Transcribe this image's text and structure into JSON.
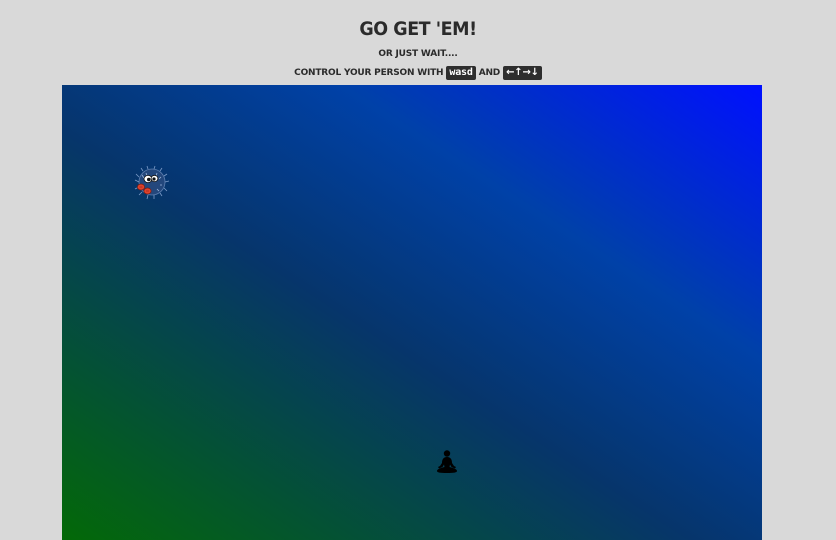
{
  "header": {
    "title": "Go get 'em!",
    "subtitle": "or just wait....",
    "controls_prefix": "control your person with",
    "wasd_key": "wasd",
    "controls_and": "and",
    "arrow_keys": [
      "←",
      "↑",
      "→",
      "↓"
    ]
  },
  "game": {
    "background_colors": {
      "bottom_left": "#036907",
      "top_right": "#0010ff"
    },
    "enemy_icon": "fuzzy-monster-icon",
    "player_icon": "meditating-person-icon"
  }
}
